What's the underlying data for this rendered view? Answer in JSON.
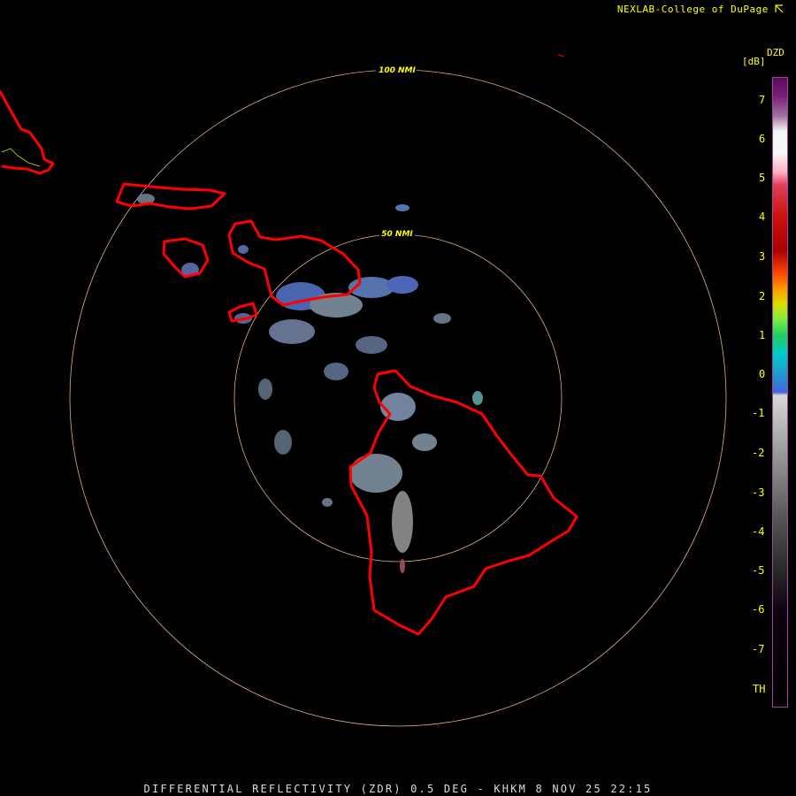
{
  "header": {
    "credit": "NEXLAB-College of DuPage",
    "credit_icon": "arrow-corner-icon"
  },
  "caption": "DIFFERENTIAL REFLECTIVITY (ZDR) 0.5 DEG - KHKM 8 NOV 25 22:15",
  "legend": {
    "product": "DZD",
    "units": "[dB]",
    "labels": [
      "7",
      "6",
      "5",
      "4",
      "3",
      "2",
      "1",
      "0",
      "-1",
      "-2",
      "-3",
      "-4",
      "-5",
      "-6",
      "-7",
      "TH"
    ]
  },
  "range_rings": [
    {
      "label": "100 NMI",
      "distance_nmi": 100
    },
    {
      "label": "50 NMI",
      "distance_nmi": 50
    }
  ],
  "colors": {
    "background": "#000000",
    "coastline": "#ff0000",
    "range_ring": "#d9b08c",
    "label_yellow": "#ffff00"
  }
}
